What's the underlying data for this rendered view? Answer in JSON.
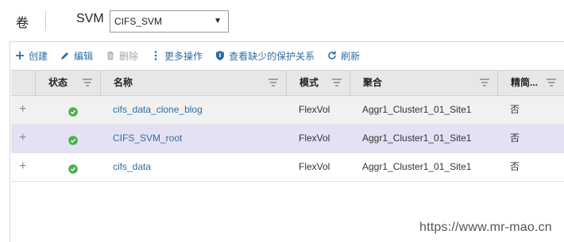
{
  "header": {
    "title": "卷",
    "svm_label": "SVM",
    "svm_selected": "CIFS_SVM"
  },
  "toolbar": {
    "create": "创建",
    "edit": "编辑",
    "delete": "删除",
    "more": "更多操作",
    "view_missing_protection": "查看缺少的保护关系",
    "refresh": "刷新"
  },
  "table": {
    "columns": {
      "status": "状态",
      "name": "名称",
      "mode": "模式",
      "aggregate": "聚合",
      "thin": "精简..."
    },
    "rows": [
      {
        "name": "cifs_data_clone_blog",
        "mode": "FlexVol",
        "aggregate": "Aggr1_Cluster1_01_Site1",
        "thin": "否",
        "status": "ok"
      },
      {
        "name": "CIFS_SVM_root",
        "mode": "FlexVol",
        "aggregate": "Aggr1_Cluster1_01_Site1",
        "thin": "否",
        "status": "ok"
      },
      {
        "name": "cifs_data",
        "mode": "FlexVol",
        "aggregate": "Aggr1_Cluster1_01_Site1",
        "thin": "否",
        "status": "ok"
      }
    ]
  },
  "watermark": "https://www.mr-mao.cn",
  "colors": {
    "link": "#2e6da4",
    "status_ok": "#4caf50",
    "selected_row": "#e5e1f4",
    "header_bg": "#e7e7e7"
  }
}
